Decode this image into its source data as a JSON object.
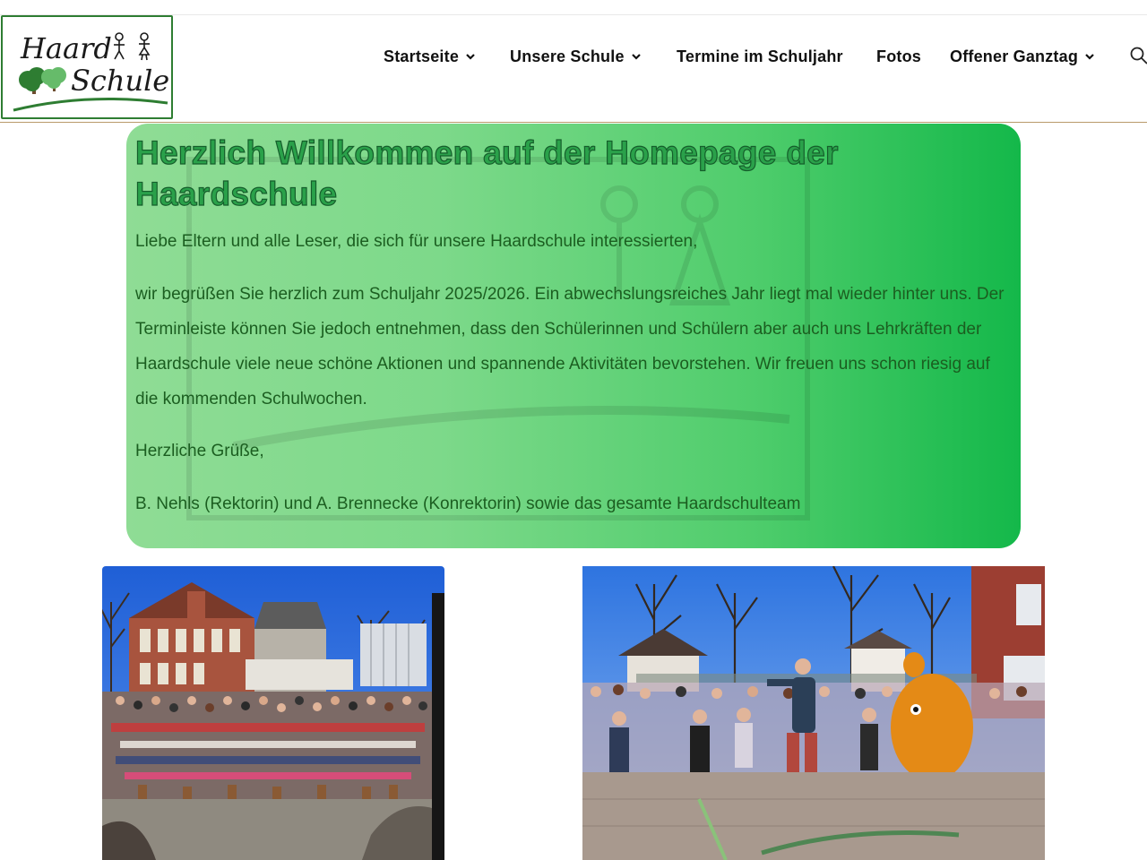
{
  "logo": {
    "line1": "Haard",
    "line2": "Schule"
  },
  "nav": {
    "items": [
      {
        "label": "Startseite",
        "has_dropdown": true
      },
      {
        "label": "Unsere Schule",
        "has_dropdown": true
      },
      {
        "label": "Termine im Schuljahr",
        "has_dropdown": false
      },
      {
        "label": "Fotos",
        "has_dropdown": false
      },
      {
        "label": "Offener Ganztag",
        "has_dropdown": true
      }
    ],
    "search_icon": "search-icon"
  },
  "welcome": {
    "title": "Herzlich Willkommen auf der Homepage der Haardschule",
    "paragraphs": [
      "Liebe Eltern und alle Leser, die sich für unsere Haardschule interessierten,",
      "wir begrüßen Sie herzlich zum Schuljahr 2025/2026. Ein abwechslungsreiches Jahr liegt mal wieder hinter uns. Der Terminleiste können Sie jedoch entnehmen, dass den Schülerinnen und Schülern aber auch uns Lehrkräften der Haardschule viele neue schöne Aktionen und spannende Aktivitäten bevorstehen. Wir freuen uns schon riesig auf die kommenden Schulwochen.",
      "Herzliche Grüße,",
      "B. Nehls (Rektorin) und A. Brennecke (Konrektorin) sowie das gesamte Haardschulteam"
    ]
  },
  "colors": {
    "brand_green": "#2e7d32",
    "title_green": "#2aa14a",
    "text_green": "#1b5e20",
    "header_line": "#b99a6a"
  }
}
